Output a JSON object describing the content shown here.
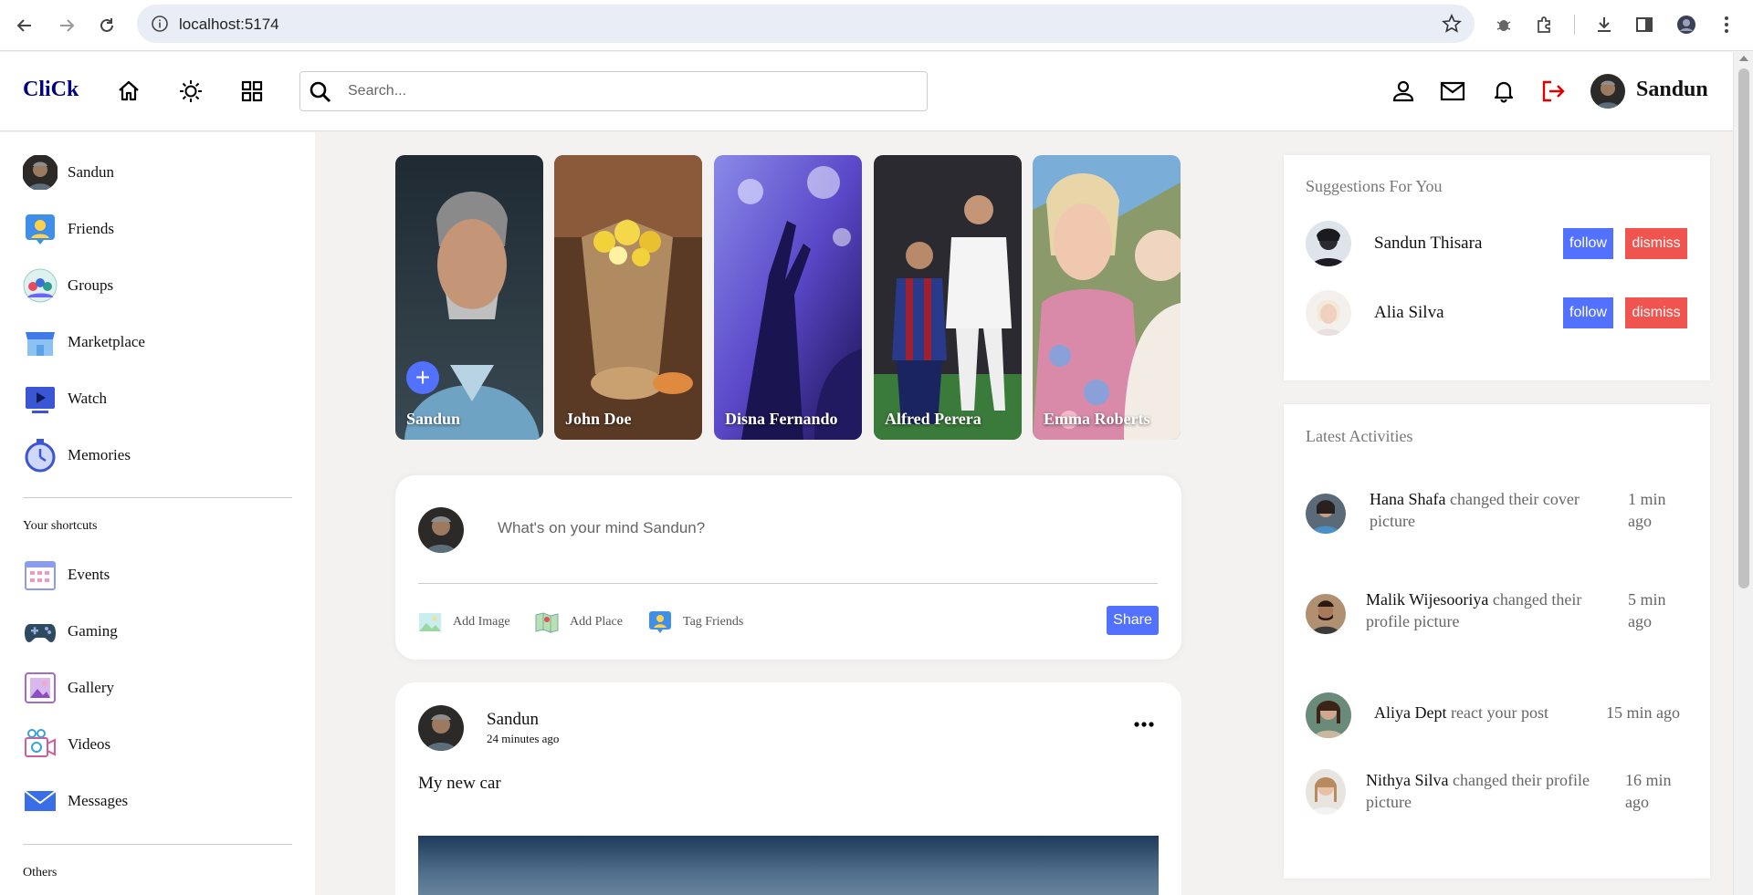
{
  "browser": {
    "url": "localhost:5174"
  },
  "navbar": {
    "logo": "CliCk",
    "search_placeholder": "Search...",
    "user_name": "Sandun"
  },
  "sidebar": {
    "items": [
      {
        "label": "Sandun",
        "icon": "user-avatar"
      },
      {
        "label": "Friends",
        "icon": "friends-icon"
      },
      {
        "label": "Groups",
        "icon": "groups-icon"
      },
      {
        "label": "Marketplace",
        "icon": "marketplace-icon"
      },
      {
        "label": "Watch",
        "icon": "watch-icon"
      },
      {
        "label": "Memories",
        "icon": "memories-icon"
      }
    ],
    "shortcuts_title": "Your shortcuts",
    "shortcuts": [
      {
        "label": "Events",
        "icon": "events-icon"
      },
      {
        "label": "Gaming",
        "icon": "gaming-icon"
      },
      {
        "label": "Gallery",
        "icon": "gallery-icon"
      },
      {
        "label": "Videos",
        "icon": "videos-icon"
      },
      {
        "label": "Messages",
        "icon": "messages-icon"
      }
    ],
    "others_title": "Others"
  },
  "stories": [
    {
      "name": "Sandun"
    },
    {
      "name": "John Doe"
    },
    {
      "name": "Disna Fernando"
    },
    {
      "name": "Alfred Perera"
    },
    {
      "name": "Emma Roberts"
    }
  ],
  "share": {
    "placeholder": "What's on your mind Sandun?",
    "add_image": "Add Image",
    "add_place": "Add Place",
    "tag_friends": "Tag Friends",
    "share_label": "Share"
  },
  "post": {
    "author": "Sandun",
    "time": "24 minutes ago",
    "text": "My new car"
  },
  "suggestions": {
    "title": "Suggestions For You",
    "follow_label": "follow",
    "dismiss_label": "dismiss",
    "people": [
      {
        "name": "Sandun Thisara"
      },
      {
        "name": "Alia Silva"
      }
    ]
  },
  "activities": {
    "title": "Latest Activities",
    "items": [
      {
        "who": "Hana Shafa",
        "action": " changed their cover picture",
        "time": "1 min ago"
      },
      {
        "who": "Malik Wijesooriya",
        "action": " changed their profile picture",
        "time": "5 min ago"
      },
      {
        "who": "Aliya Dept",
        "action": " react your post",
        "time": "15 min ago"
      },
      {
        "who": "Nithya Silva",
        "action": " changed their profile picture",
        "time": "16 min ago"
      }
    ]
  },
  "colors": {
    "accent": "#5271ff",
    "danger": "#f0544f",
    "logo": "#000080",
    "logout": "#e00000"
  }
}
